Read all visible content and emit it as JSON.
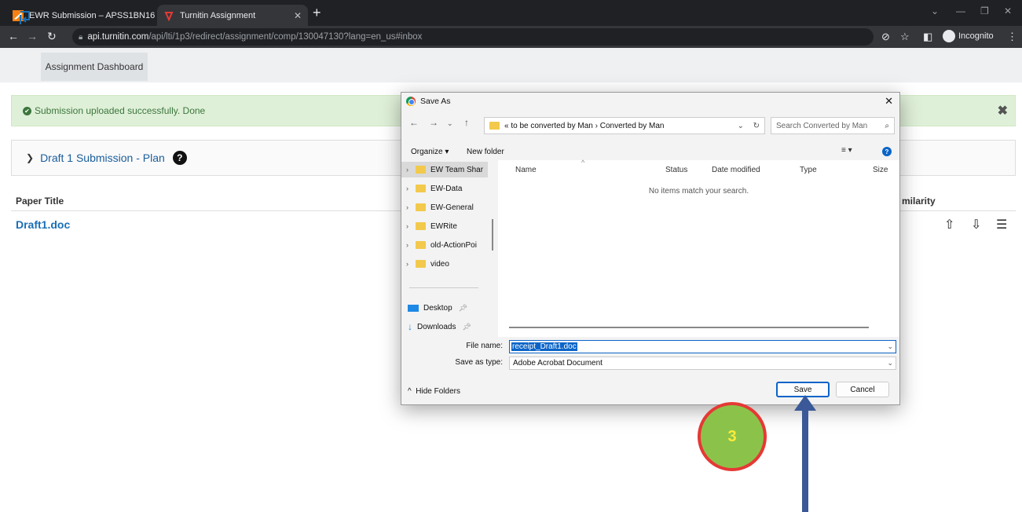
{
  "browser": {
    "tabs": [
      {
        "title": "EWR Submission – APSS1BN16 E",
        "close": "✕"
      },
      {
        "title": "Turnitin Assignment",
        "close": "✕"
      }
    ],
    "new_tab": "+",
    "url_host": "api.turnitin.com",
    "url_path": "/api/lti/1p3/redirect/assignment/comp/130047130?lang=en_us#inbox",
    "incognito_label": "Incognito"
  },
  "page": {
    "nav_tab": "Assignment Dashboard",
    "alert_text": "Submission uploaded successfully. Done",
    "alert_close": "✖",
    "draft_title": "Draft 1 Submission - Plan",
    "help": "?",
    "columns": {
      "paper_title": "Paper Title",
      "similarity": "milarity"
    },
    "paper": "Draft1.doc"
  },
  "dialog": {
    "title": "Save As",
    "close": "✕",
    "breadcrumb_prefix": "«",
    "breadcrumb": [
      "to be converted by Man",
      "Converted by Man"
    ],
    "search_placeholder": "Search Converted by Man",
    "organize": "Organize ▾",
    "new_folder": "New folder",
    "nav_items": [
      "EW Team Shar",
      "EW-Data",
      "EW-General",
      "EWRite",
      "old-ActionPoi",
      "video"
    ],
    "quick_access": [
      "Desktop",
      "Downloads"
    ],
    "columns": [
      "Name",
      "Status",
      "Date modified",
      "Type",
      "Size"
    ],
    "empty_message": "No items match your search.",
    "file_name_label": "File name:",
    "file_name_value": "receipt_Draft1.doc",
    "save_type_label": "Save as type:",
    "save_type_value": "Adobe Acrobat Document",
    "hide_folders": "Hide Folders",
    "save_button": "Save",
    "cancel_button": "Cancel"
  },
  "annotation": {
    "step": "3",
    "colors": {
      "badge_fill": "#8bc34a",
      "badge_ring": "#e53935",
      "arrow": "#3b5998"
    }
  }
}
